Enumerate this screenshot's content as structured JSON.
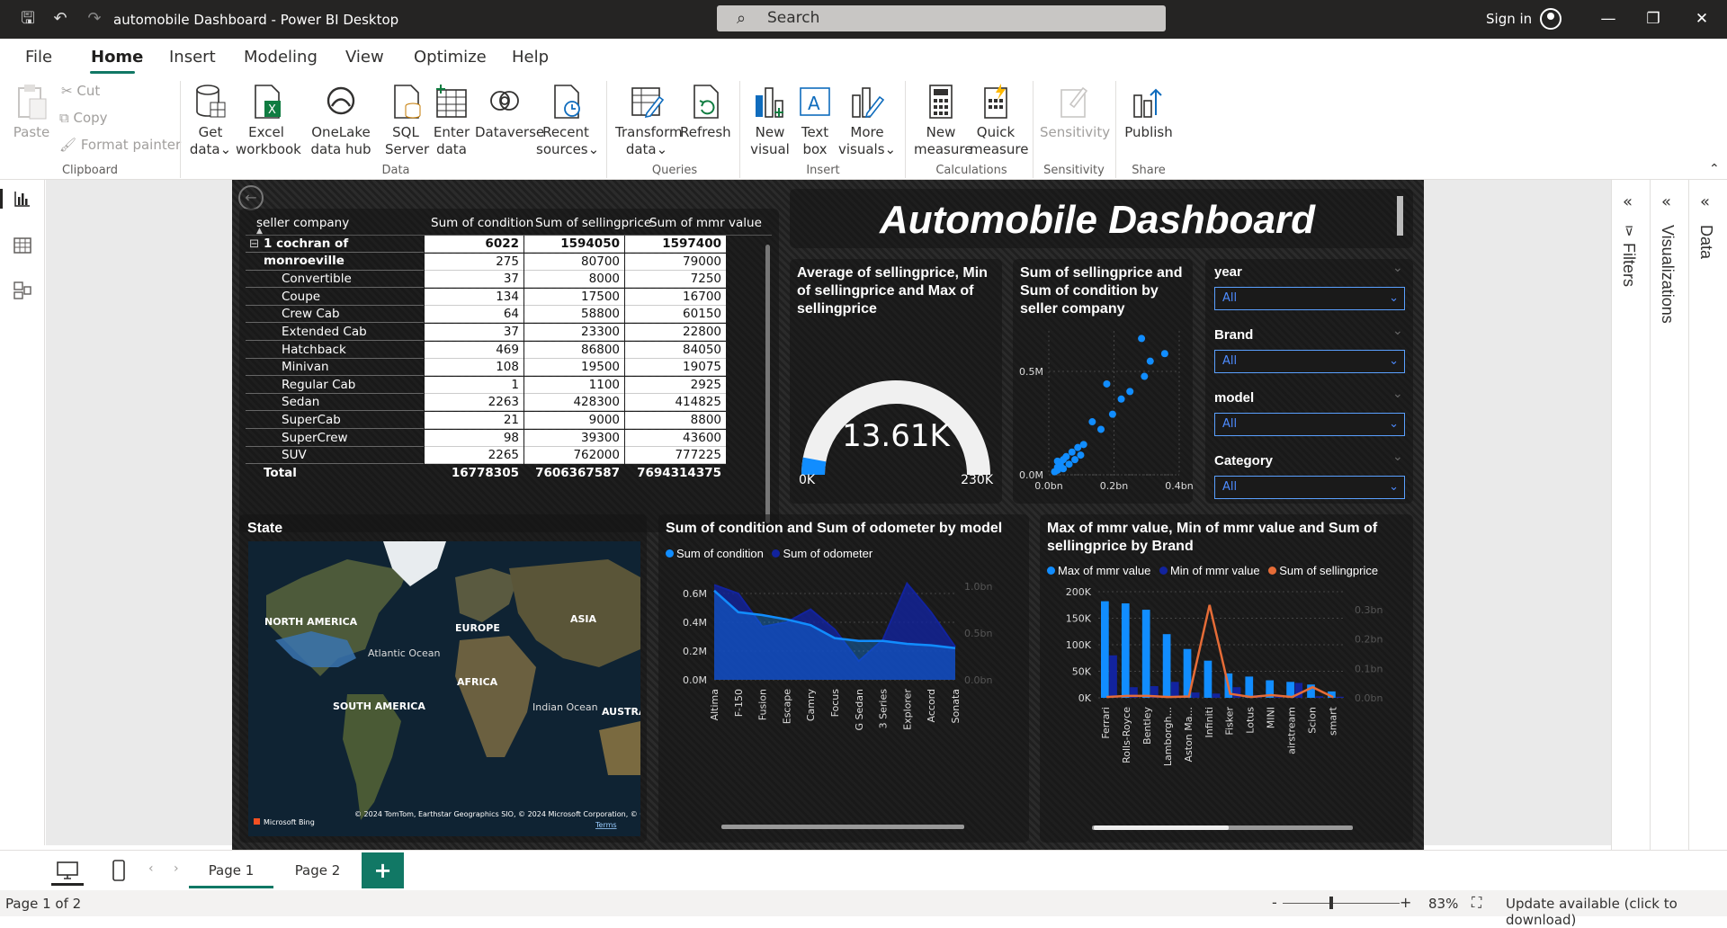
{
  "window": {
    "title": "automobile Dashboard - Power BI Desktop",
    "search_placeholder": "Search",
    "signin": "Sign in"
  },
  "menu": [
    "File",
    "Home",
    "Insert",
    "Modeling",
    "View",
    "Optimize",
    "Help"
  ],
  "ribbon": {
    "clipboard": {
      "paste": "Paste",
      "cut": "Cut",
      "copy": "Copy",
      "format_painter": "Format painter",
      "group": "Clipboard"
    },
    "data": {
      "get_data": "Get data",
      "excel": "Excel workbook",
      "onelake": "OneLake data hub",
      "sql": "SQL Server",
      "enter": "Enter data",
      "dataverse": "Dataverse",
      "recent": "Recent sources",
      "group": "Data"
    },
    "queries": {
      "transform": "Transform data",
      "refresh": "Refresh",
      "group": "Queries"
    },
    "insert": {
      "new_visual": "New visual",
      "text_box": "Text box",
      "more_visuals": "More visuals",
      "group": "Insert"
    },
    "calculations": {
      "new_measure": "New measure",
      "quick_measure": "Quick measure",
      "group": "Calculations"
    },
    "sensitivity": {
      "label": "Sensitivity",
      "group": "Sensitivity"
    },
    "share": {
      "publish": "Publish",
      "group": "Share"
    }
  },
  "report": {
    "title": "Automobile Dashboard",
    "table": {
      "headers": [
        "seller company",
        "Sum of condition",
        "Sum of sellingprice",
        "Sum of mmr value"
      ],
      "group": {
        "name": "1 cochran of monroeville",
        "values": [
          "6022",
          "1594050",
          "1597400"
        ]
      },
      "rows": [
        {
          "name": "",
          "values": [
            "275",
            "80700",
            "79000"
          ]
        },
        {
          "name": "Convertible",
          "values": [
            "37",
            "8000",
            "7250"
          ]
        },
        {
          "name": "Coupe",
          "values": [
            "134",
            "17500",
            "16700"
          ]
        },
        {
          "name": "Crew Cab",
          "values": [
            "64",
            "58800",
            "60150"
          ]
        },
        {
          "name": "Extended Cab",
          "values": [
            "37",
            "23300",
            "22800"
          ]
        },
        {
          "name": "Hatchback",
          "values": [
            "469",
            "86800",
            "84050"
          ]
        },
        {
          "name": "Minivan",
          "values": [
            "108",
            "19500",
            "19075"
          ]
        },
        {
          "name": "Regular Cab",
          "values": [
            "1",
            "1100",
            "2925"
          ]
        },
        {
          "name": "Sedan",
          "values": [
            "2263",
            "428300",
            "414825"
          ]
        },
        {
          "name": "SuperCab",
          "values": [
            "21",
            "9000",
            "8800"
          ]
        },
        {
          "name": "SuperCrew",
          "values": [
            "98",
            "39300",
            "43600"
          ]
        },
        {
          "name": "SUV",
          "values": [
            "2265",
            "762000",
            "777225"
          ]
        }
      ],
      "total": {
        "name": "Total",
        "values": [
          "16778305",
          "7606367587",
          "7694314375"
        ]
      }
    },
    "gauge": {
      "title": "Average of sellingprice, Min of sellingprice and Max of sellingprice",
      "value_label": "13.61K",
      "min_label": "0K",
      "max_label": "230K",
      "value": 13610,
      "min": 0,
      "max": 230000
    },
    "scatter": {
      "title": "Sum of sellingprice and Sum of condition by seller company",
      "y_ticks": [
        "0.5M",
        "0.0M"
      ],
      "x_ticks": [
        "0.0bn",
        "0.2bn",
        "0.4bn"
      ]
    },
    "slicers": [
      {
        "title": "year",
        "value": "All"
      },
      {
        "title": "Brand",
        "value": "All"
      },
      {
        "title": "model",
        "value": "All"
      },
      {
        "title": "Category",
        "value": "All"
      }
    ],
    "map": {
      "title": "State",
      "labels": [
        "NORTH AMERICA",
        "EUROPE",
        "ASIA",
        "Atlantic Ocean",
        "AFRICA",
        "SOUTH AMERICA",
        "Indian Ocean",
        "AUSTRA"
      ],
      "credit": "© 2024 TomTom, Earthstar Geographics SIO, © 2024 Microsoft Corporation, © OpenStreetMap",
      "terms": "Terms",
      "bing": "Microsoft Bing"
    }
  },
  "chart_data": [
    {
      "type": "area",
      "title": "Sum of condition and Sum of odometer by model",
      "categories": [
        "Altima",
        "F-150",
        "Fusion",
        "Escape",
        "Camry",
        "Focus",
        "G Sedan",
        "3 Series",
        "Explorer",
        "Accord",
        "Sonata"
      ],
      "series": [
        {
          "name": "Sum of condition",
          "values": [
            0.62,
            0.47,
            0.45,
            0.42,
            0.38,
            0.29,
            0.27,
            0.27,
            0.25,
            0.24,
            0.22
          ]
        },
        {
          "name": "Sum of odometer",
          "values": [
            0.66,
            0.6,
            0.37,
            0.4,
            0.49,
            0.35,
            0.13,
            0.28,
            0.67,
            0.47,
            0.23
          ]
        }
      ],
      "y_ticks": [
        "0.6M",
        "0.4M",
        "0.2M",
        "0.0M"
      ],
      "y2_ticks": [
        "1.0bn",
        "0.5bn",
        "0.0bn"
      ],
      "ylim": [
        0,
        0.65
      ],
      "colors": {
        "Sum of condition": "#118dff",
        "Sum of odometer": "#12239e"
      }
    },
    {
      "type": "bar",
      "title": "Max of mmr value, Min of mmr value and Sum of sellingprice by Brand",
      "categories": [
        "Ferrari",
        "Rolls-Royce",
        "Bentley",
        "Lamborgh...",
        "Aston Ma...",
        "Infiniti",
        "Fisker",
        "Lotus",
        "MINI",
        "airstream",
        "Scion",
        "smart"
      ],
      "series": [
        {
          "name": "Max of mmr value",
          "values": [
            182000,
            178000,
            166000,
            120000,
            92000,
            70000,
            46000,
            40000,
            33000,
            30000,
            25000,
            12000
          ]
        },
        {
          "name": "Min of mmr value",
          "values": [
            80000,
            20000,
            22000,
            30000,
            10000,
            8000,
            20000,
            5000,
            2000,
            28000,
            3000,
            2000
          ]
        },
        {
          "name": "Sum of sellingprice",
          "values": [
            0.003,
            0.007,
            0.007,
            0.003,
            0.005,
            0.35,
            0.015,
            0.003,
            0.01,
            0.003,
            0.04,
            0.002
          ]
        }
      ],
      "y_ticks": [
        "200K",
        "150K",
        "100K",
        "50K",
        "0K"
      ],
      "y2_ticks": [
        "0.3bn",
        "0.2bn",
        "0.1bn",
        "0.0bn"
      ],
      "ylim": [
        0,
        200000
      ],
      "colors": {
        "Max of mmr value": "#118dff",
        "Min of mmr value": "#12239e",
        "Sum of sellingprice": "#e66c37"
      }
    }
  ],
  "panes": {
    "filters": "Filters",
    "visualizations": "Visualizations",
    "data": "Data"
  },
  "pages": {
    "page1": "Page 1",
    "page2": "Page 2"
  },
  "status": {
    "page": "Page 1 of 2",
    "zoom": "83%",
    "update": "Update available (click to download)"
  }
}
